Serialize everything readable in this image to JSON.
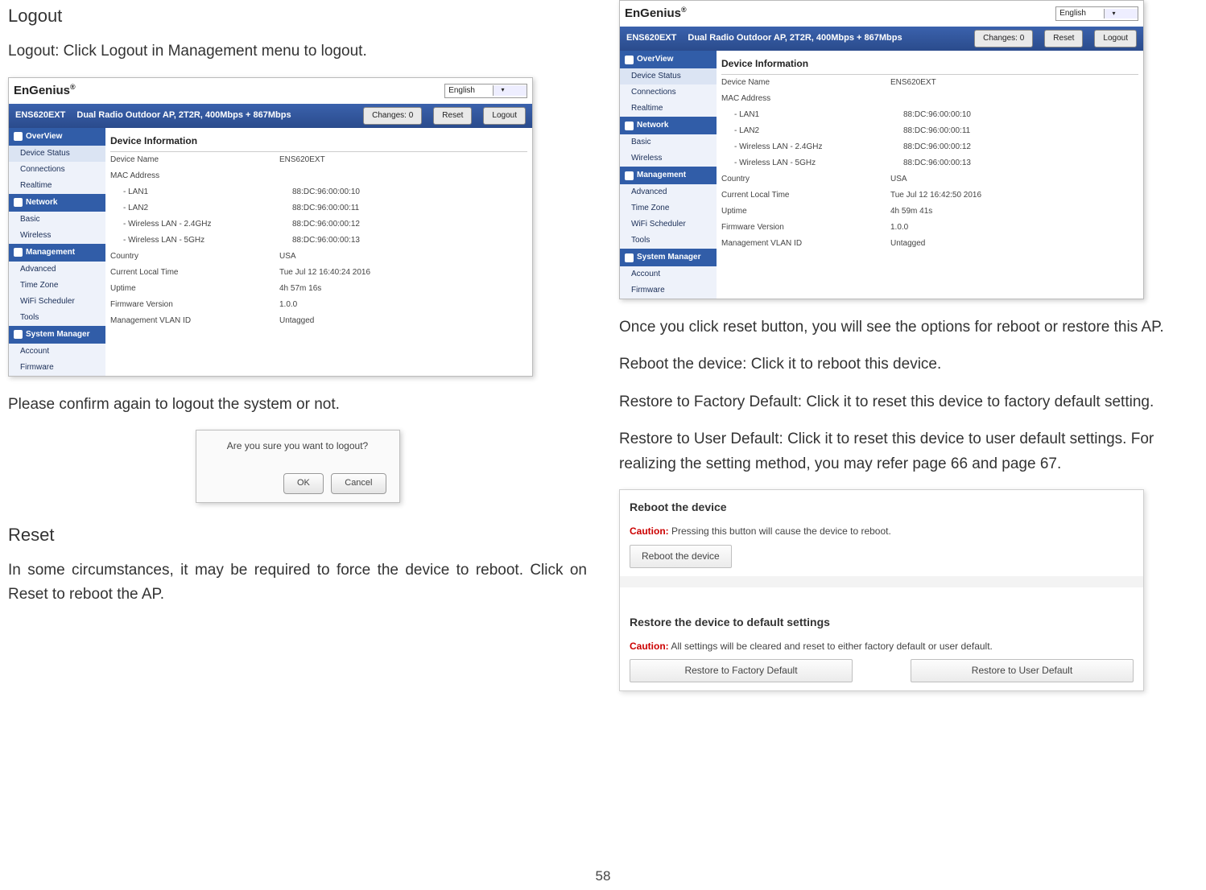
{
  "left": {
    "h_logout": "Logout",
    "p_logout": "Logout: Click Logout  in Management menu to logout.",
    "p_confirm": "Please confirm again to logout the system or not.",
    "h_reset": "Reset",
    "p_reset": "In some circumstances, it may be required to force the device to reboot. Click on Reset to reboot the AP."
  },
  "right": {
    "p_reset_options": "Once you click reset button, you will see the options for reboot or restore this AP.",
    "p_reboot_device": "Reboot the device: Click it to reboot this device.",
    "p_restore_factory": "Restore to Factory Default: Click it to reset this device to factory default setting.",
    "p_restore_user": "Restore to User Default: Click it to reset this device to user default settings. For realizing the setting method, you may refer page 66 and page 67."
  },
  "admin": {
    "logo": "EnGenius",
    "lang": "English",
    "model": "ENS620EXT",
    "subtitle": "Dual Radio Outdoor AP, 2T2R, 400Mbps + 867Mbps",
    "changes": "Changes: 0",
    "reset": "Reset",
    "logout": "Logout",
    "sidebar": {
      "overview": "OverView",
      "overview_items": [
        "Device Status",
        "Connections",
        "Realtime"
      ],
      "network": "Network",
      "network_items": [
        "Basic",
        "Wireless"
      ],
      "management": "Management",
      "management_items": [
        "Advanced",
        "Time Zone",
        "WiFi Scheduler",
        "Tools"
      ],
      "system": "System Manager",
      "system_items": [
        "Account",
        "Firmware"
      ]
    },
    "device_info_title": "Device Information",
    "rows_left": [
      {
        "label": "Device Name",
        "value": "ENS620EXT"
      },
      {
        "label": "MAC Address",
        "value": ""
      },
      {
        "label": "- LAN1",
        "value": "88:DC:96:00:00:10",
        "indent": true
      },
      {
        "label": "- LAN2",
        "value": "88:DC:96:00:00:11",
        "indent": true
      },
      {
        "label": "- Wireless LAN - 2.4GHz",
        "value": "88:DC:96:00:00:12",
        "indent": true
      },
      {
        "label": "- Wireless LAN - 5GHz",
        "value": "88:DC:96:00:00:13",
        "indent": true
      },
      {
        "label": "Country",
        "value": "USA"
      },
      {
        "label": "Current Local Time",
        "value": "Tue Jul 12 16:40:24 2016"
      },
      {
        "label": "Uptime",
        "value": "4h 57m 16s"
      },
      {
        "label": "Firmware Version",
        "value": "1.0.0"
      },
      {
        "label": "Management VLAN ID",
        "value": "Untagged"
      }
    ],
    "rows_right": [
      {
        "label": "Device Name",
        "value": "ENS620EXT"
      },
      {
        "label": "MAC Address",
        "value": ""
      },
      {
        "label": "- LAN1",
        "value": "88:DC:96:00:00:10",
        "indent": true
      },
      {
        "label": "- LAN2",
        "value": "88:DC:96:00:00:11",
        "indent": true
      },
      {
        "label": "- Wireless LAN - 2.4GHz",
        "value": "88:DC:96:00:00:12",
        "indent": true
      },
      {
        "label": "- Wireless LAN - 5GHz",
        "value": "88:DC:96:00:00:13",
        "indent": true
      },
      {
        "label": "Country",
        "value": "USA"
      },
      {
        "label": "Current Local Time",
        "value": "Tue Jul 12 16:42:50 2016"
      },
      {
        "label": "Uptime",
        "value": "4h 59m 41s"
      },
      {
        "label": "Firmware Version",
        "value": "1.0.0"
      },
      {
        "label": "Management VLAN ID",
        "value": "Untagged"
      }
    ]
  },
  "dialog": {
    "msg": "Are you sure you want to logout?",
    "ok": "OK",
    "cancel": "Cancel"
  },
  "panel": {
    "reboot_h": "Reboot the device",
    "caution_lead": "Caution:",
    "reboot_caution": "Pressing this button will cause the device to reboot.",
    "reboot_btn": "Reboot the device",
    "restore_h": "Restore the device to default settings",
    "restore_caution": "All settings will be cleared and reset to either factory default or user default.",
    "restore_factory_btn": "Restore to Factory Default",
    "restore_user_btn": "Restore to User Default"
  },
  "pagenum": "58"
}
